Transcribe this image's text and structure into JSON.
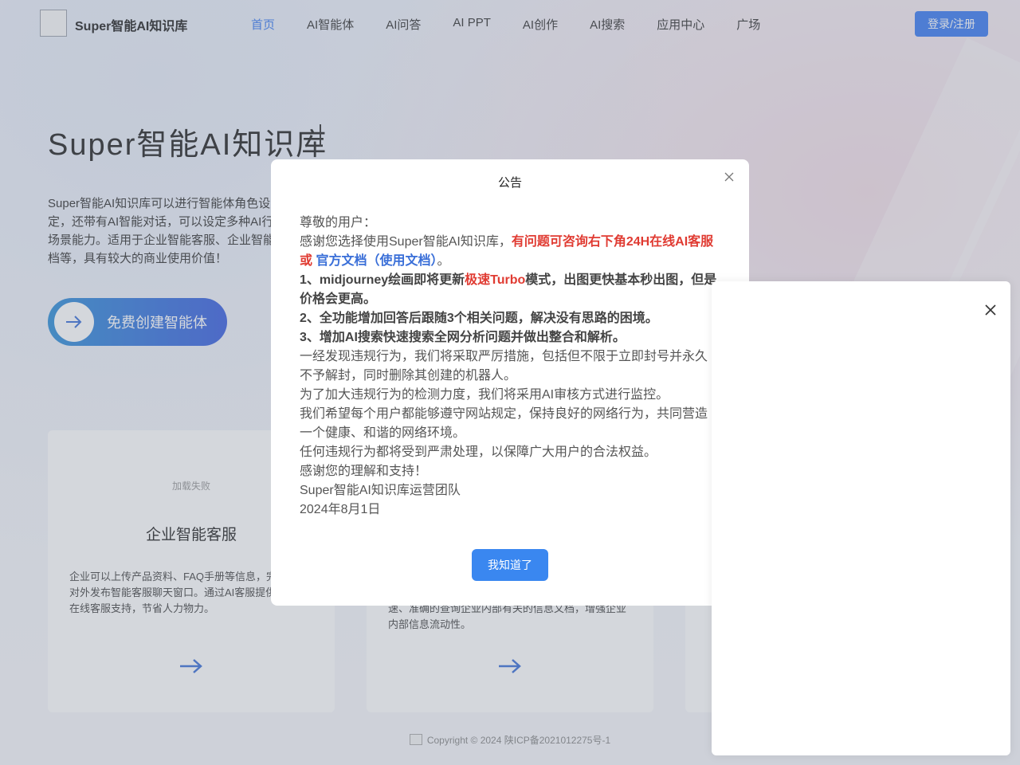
{
  "header": {
    "logo_text": "Super智能AI知识库",
    "nav": [
      "首页",
      "AI智能体",
      "AI问答",
      "AI PPT",
      "AI创作",
      "AI搜索",
      "应用中心",
      "广场"
    ],
    "login_label": "登录/注册"
  },
  "hero": {
    "title": "Super智能AI知识库",
    "description": "Super智能AI知识库可以进行智能体角色设定，还带有AI智能对话，可以设定多种AI行业场景能力。适用于企业智能客服、企业智能文档等，具有较大的商业使用价值！",
    "cta_label": "免费创建智能体"
  },
  "cards": [
    {
      "image_alt": "加载失败",
      "title": "企业智能客服",
      "description": "企业可以上传产品资料、FAQ手册等信息，完成后，对外发布智能客服聊天窗口。通过AI客服提供24小时在线客服支持，节省人力物力。"
    },
    {
      "image_alt": "",
      "title": "",
      "description": "速、准确的查询企业内部有关的信息文档，增强企业内部信息流动性。"
    },
    {
      "image_alt": "",
      "title": "",
      "description": ""
    }
  ],
  "footer": {
    "copyright": "Copyright © 2024 陕ICP备2021012275号-1"
  },
  "modal": {
    "title": "公告",
    "greeting": "尊敬的用户：",
    "line1_prefix": "感谢您选择使用Super智能AI知识库，",
    "line1_red": "有问题可咨询右下角24H在线AI客服",
    "line1_or": "或",
    "line1_link": "官方文档（使用文档）",
    "line1_end": "。",
    "item1_a": "1、midjourney绘画即将更新",
    "item1_red": "极速Turbo",
    "item1_b": "模式，出图更快基本秒出图，但是价格会更高。",
    "item2": "2、全功能增加回答后跟随3个相关问题，解决没有思路的困境。",
    "item3": "3、增加AI搜索快速搜索全网分析问题并做出整合和解析。",
    "para1": "一经发现违规行为，我们将采取严厉措施，包括但不限于立即封号并永久不予解封，同时删除其创建的机器人。",
    "para2": "为了加大违规行为的检测力度，我们将采用AI审核方式进行监控。",
    "para3": "我们希望每个用户都能够遵守网站规定，保持良好的网络行为，共同营造一个健康、和谐的网络环境。",
    "para4": "任何违规行为都将受到严肃处理，以保障广大用户的合法权益。",
    "para5": "感谢您的理解和支持！",
    "signature": "Super智能AI知识库运营团队",
    "date": "2024年8月1日",
    "ok_label": "我知道了"
  },
  "colors": {
    "accent": "#3a7bf2",
    "highlight_red": "#e03b32",
    "link_blue": "#3a6fd8"
  }
}
